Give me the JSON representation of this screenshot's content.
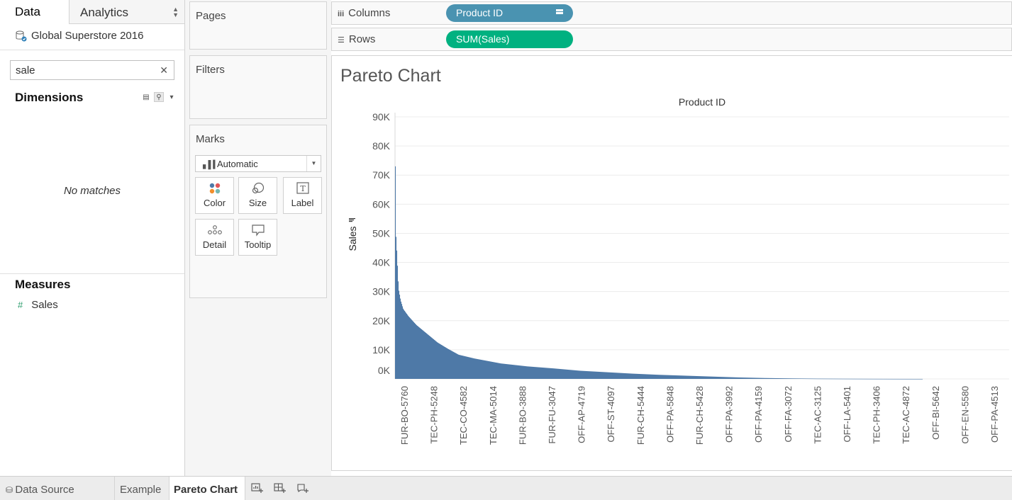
{
  "left_pane": {
    "tabs": {
      "data": "Data",
      "analytics": "Analytics"
    },
    "datasource": "Global Superstore 2016",
    "search": {
      "value": "sale"
    },
    "dimensions_title": "Dimensions",
    "no_matches": "No matches",
    "measures_title": "Measures",
    "measures": [
      {
        "name": "Sales",
        "type_icon": "#"
      }
    ]
  },
  "shelves": {
    "pages": "Pages",
    "filters": "Filters",
    "marks": {
      "title": "Marks",
      "type": "Automatic",
      "buttons": [
        "Color",
        "Size",
        "Label",
        "Detail",
        "Tooltip"
      ]
    },
    "columns": {
      "label": "Columns",
      "pill": "Product ID"
    },
    "rows": {
      "label": "Rows",
      "pill": "SUM(Sales)"
    }
  },
  "sheet": {
    "title": "Pareto Chart"
  },
  "bottom_tabs": [
    "Data Source",
    "Example",
    "Pareto Chart"
  ],
  "colors": {
    "bar": "#4e79a7",
    "columns_pill": "#4a93b1",
    "rows_pill": "#00b180"
  },
  "chart_data": {
    "type": "bar",
    "title": "Product ID",
    "xlabel": "Product ID",
    "ylabel": "Sales",
    "ylim": [
      0,
      90000
    ],
    "y_ticks": [
      0,
      10000,
      20000,
      30000,
      40000,
      50000,
      60000,
      70000,
      80000,
      90000
    ],
    "y_tick_labels": [
      "0K",
      "10K",
      "20K",
      "30K",
      "40K",
      "50K",
      "60K",
      "70K",
      "80K",
      "90K"
    ],
    "categories": [
      "FUR-BO-5760",
      "TEC-PH-5248",
      "TEC-CO-4582",
      "TEC-MA-5014",
      "FUR-BO-3888",
      "FUR-FU-3047",
      "OFF-AP-4719",
      "OFF-ST-4097",
      "FUR-CH-5444",
      "OFF-PA-5848",
      "FUR-CH-5428",
      "OFF-PA-3992",
      "OFF-PA-4159",
      "OFF-FA-3072",
      "TEC-AC-3125",
      "OFF-LA-5401",
      "TEC-PH-3406",
      "TEC-AC-4872",
      "OFF-BI-5642",
      "OFF-EN-5580",
      "OFF-PA-4513"
    ],
    "sorted": "descending",
    "profile": [
      [
        0.0,
        73000
      ],
      [
        0.001,
        50000
      ],
      [
        0.003,
        43000
      ],
      [
        0.006,
        31000
      ],
      [
        0.01,
        27000
      ],
      [
        0.015,
        24000
      ],
      [
        0.025,
        21500
      ],
      [
        0.04,
        18500
      ],
      [
        0.06,
        15500
      ],
      [
        0.08,
        12500
      ],
      [
        0.1,
        10300
      ],
      [
        0.12,
        8300
      ],
      [
        0.15,
        7000
      ],
      [
        0.2,
        5300
      ],
      [
        0.25,
        4300
      ],
      [
        0.3,
        3600
      ],
      [
        0.35,
        2800
      ],
      [
        0.4,
        2300
      ],
      [
        0.45,
        1800
      ],
      [
        0.5,
        1400
      ],
      [
        0.55,
        1100
      ],
      [
        0.6,
        800
      ],
      [
        0.65,
        500
      ],
      [
        0.7,
        300
      ],
      [
        0.75,
        180
      ],
      [
        0.8,
        100
      ],
      [
        0.85,
        60
      ],
      [
        0.9,
        30
      ],
      [
        0.95,
        10
      ],
      [
        1.0,
        0
      ]
    ]
  }
}
